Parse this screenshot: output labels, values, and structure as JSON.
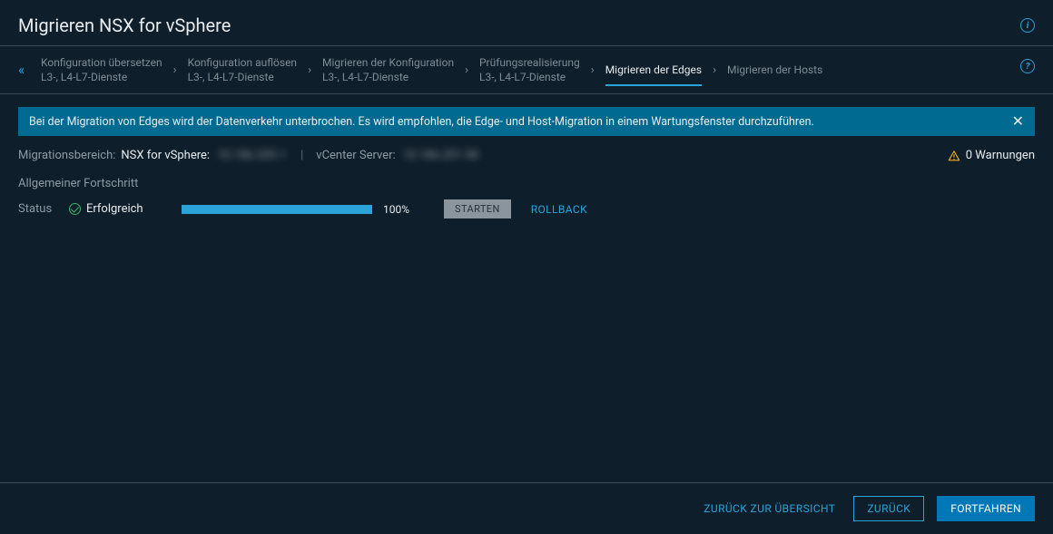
{
  "header": {
    "title": "Migrieren NSX for vSphere"
  },
  "breadcrumb": {
    "steps": [
      {
        "line1": "Konfiguration übersetzen",
        "line2": "L3-, L4-L7-Dienste"
      },
      {
        "line1": "Konfiguration auflösen",
        "line2": "L3-, L4-L7-Dienste"
      },
      {
        "line1": "Migrieren der Konfiguration",
        "line2": "L3-, L4-L7-Dienste"
      },
      {
        "line1": "Prüfungsrealisierung",
        "line2": "L3-, L4-L7-Dienste"
      },
      {
        "line1": "Migrieren der Edges",
        "line2": ""
      },
      {
        "line1": "Migrieren der Hosts",
        "line2": ""
      }
    ],
    "active_index": 4
  },
  "alert": {
    "text": "Bei der Migration von Edges wird der Datenverkehr unterbrochen. Es wird empfohlen, die Edge- und Host-Migration in einem Wartungsfenster durchzuführen."
  },
  "meta": {
    "scope_label": "Migrationsbereich:",
    "nsx_label": "NSX for vSphere:",
    "nsx_value": "10.186.205.1",
    "vcenter_label": "vCenter Server:",
    "vcenter_value": "10.186.201.98",
    "warnings_text": "0 Warnungen"
  },
  "progress": {
    "section_title": "Allgemeiner Fortschritt",
    "status_label": "Status",
    "status_text": "Erfolgreich",
    "percent_text": "100%",
    "start_button": "STARTEN",
    "rollback_link": "ROLLBACK"
  },
  "footer": {
    "overview_link": "ZURÜCK ZUR ÜBERSICHT",
    "back_button": "ZURÜCK",
    "continue_button": "FORTFAHREN"
  }
}
